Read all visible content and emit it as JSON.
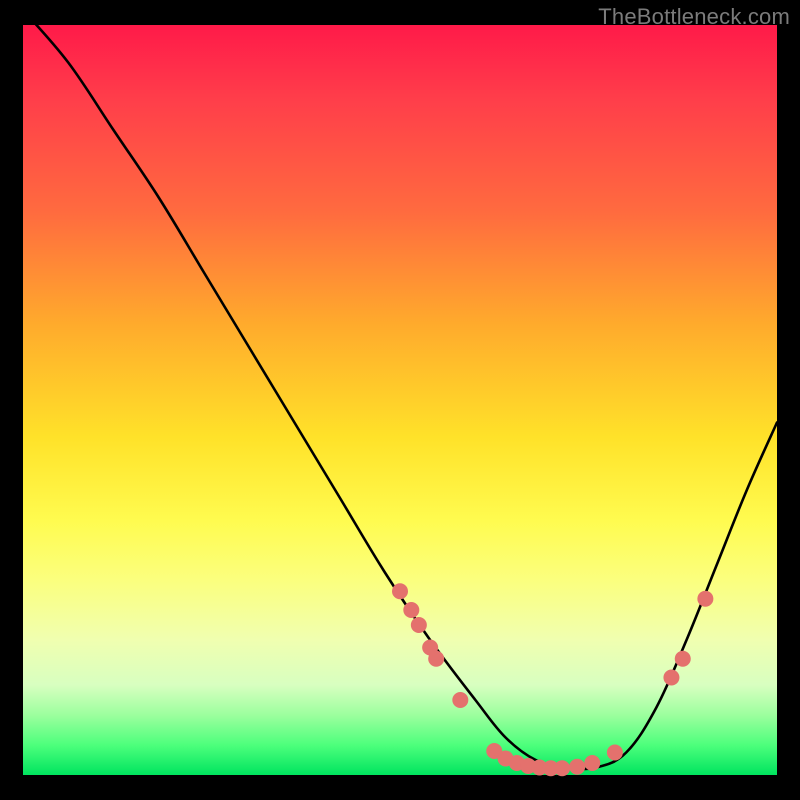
{
  "watermark": "TheBottleneck.com",
  "chart_data": {
    "type": "line",
    "title": "",
    "xlabel": "",
    "ylabel": "",
    "xlim": [
      0,
      100
    ],
    "ylim": [
      0,
      100
    ],
    "grid": false,
    "series": [
      {
        "name": "curve",
        "x": [
          0,
          6,
          12,
          18,
          24,
          30,
          36,
          42,
          48,
          54,
          60,
          64,
          68,
          72,
          76,
          80,
          84,
          88,
          92,
          96,
          100
        ],
        "y": [
          102,
          95,
          86,
          77,
          67,
          57,
          47,
          37,
          27,
          18,
          10,
          5,
          2,
          1,
          1,
          3,
          9,
          18,
          28,
          38,
          47
        ],
        "color": "#000000"
      }
    ],
    "markers": [
      {
        "x": 50.0,
        "y": 24.5
      },
      {
        "x": 51.5,
        "y": 22.0
      },
      {
        "x": 52.5,
        "y": 20.0
      },
      {
        "x": 54.0,
        "y": 17.0
      },
      {
        "x": 54.8,
        "y": 15.5
      },
      {
        "x": 58.0,
        "y": 10.0
      },
      {
        "x": 62.5,
        "y": 3.2
      },
      {
        "x": 64.0,
        "y": 2.2
      },
      {
        "x": 65.5,
        "y": 1.6
      },
      {
        "x": 67.0,
        "y": 1.2
      },
      {
        "x": 68.5,
        "y": 1.0
      },
      {
        "x": 70.0,
        "y": 0.9
      },
      {
        "x": 71.5,
        "y": 0.9
      },
      {
        "x": 73.5,
        "y": 1.1
      },
      {
        "x": 75.5,
        "y": 1.6
      },
      {
        "x": 78.5,
        "y": 3.0
      },
      {
        "x": 86.0,
        "y": 13.0
      },
      {
        "x": 87.5,
        "y": 15.5
      },
      {
        "x": 90.5,
        "y": 23.5
      }
    ],
    "marker_color": "#e4716d",
    "marker_radius": 8
  }
}
